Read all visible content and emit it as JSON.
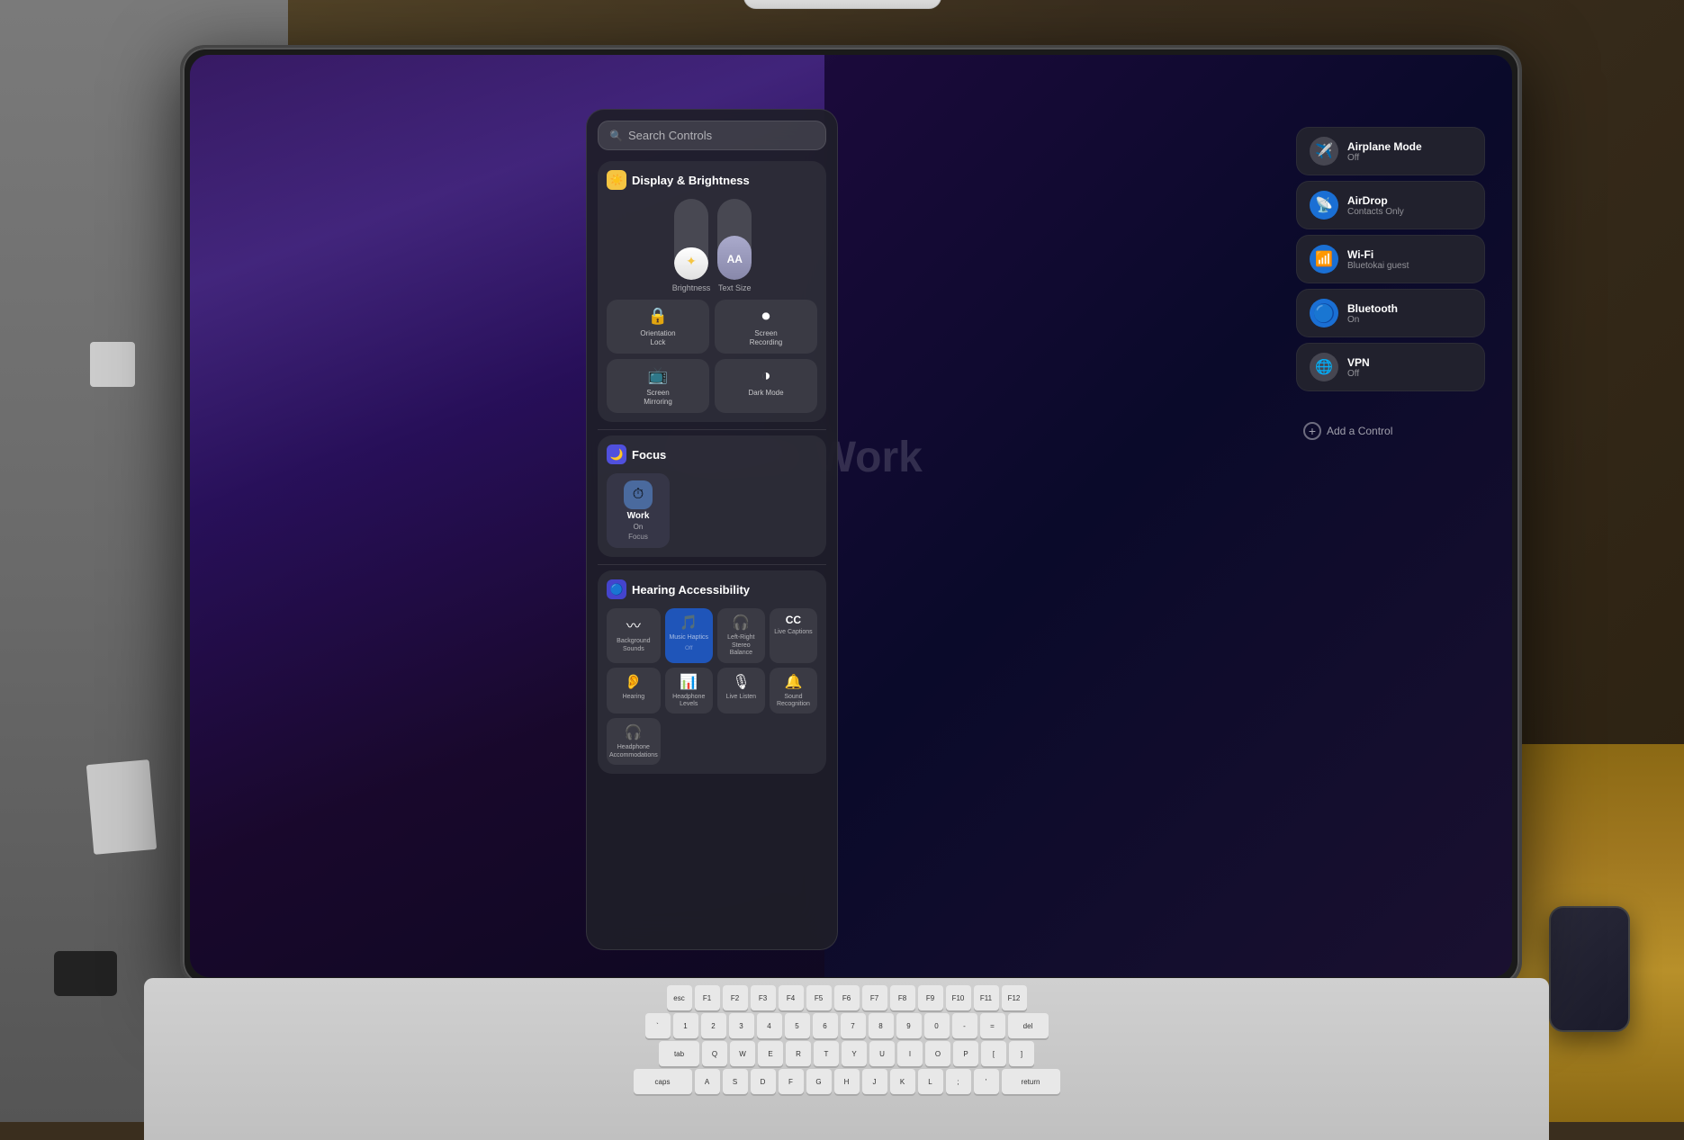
{
  "scene": {
    "apple_pencil": "Apple Pencil"
  },
  "search": {
    "placeholder": "Search Controls",
    "icon": "🔍"
  },
  "display_section": {
    "title": "Display & Brightness",
    "icon": "☀️",
    "icon_color": "#f5c542",
    "brightness_label": "Brightness",
    "text_size_label": "Text Size",
    "controls": [
      {
        "label": "Orientation\nLock",
        "icon": "🔒",
        "active": false
      },
      {
        "label": "Screen\nRecording",
        "icon": "⏺",
        "active": false
      },
      {
        "label": "Screen\nMirroring",
        "icon": "📺",
        "active": false
      },
      {
        "label": "Dark Mode",
        "icon": "◑",
        "active": false
      }
    ]
  },
  "focus_section": {
    "title": "Focus",
    "icon": "🌙",
    "icon_color": "#5050dd",
    "items": [
      {
        "name": "Work",
        "status": "On",
        "label": "Focus",
        "icon": "⏱",
        "active": true
      }
    ]
  },
  "hearing_section": {
    "title": "Hearing Accessibility",
    "icon": "🔵",
    "icon_color": "#4444cc",
    "items": [
      {
        "label": "Background\nSounds",
        "icon": "〰",
        "sublabel": "",
        "active": false
      },
      {
        "label": "Music Haptics",
        "sublabel": "Off",
        "icon": "🎵",
        "active": true
      },
      {
        "label": "Left-Right\nStereo Balance",
        "icon": "🎧",
        "active": false
      },
      {
        "label": "Live Captions",
        "icon": "CC",
        "active": false
      },
      {
        "label": "Hearing",
        "icon": "👂",
        "active": false
      },
      {
        "label": "Headphone\nLevels",
        "icon": "📊",
        "active": false
      },
      {
        "label": "Live Listen",
        "icon": "🎙",
        "active": false
      },
      {
        "label": "Sound\nRecognition",
        "icon": "🔔",
        "active": false
      },
      {
        "label": "Headphone\nAccommodations",
        "icon": "🎧",
        "active": false
      }
    ]
  },
  "connectivity": {
    "items": [
      {
        "name": "Airplane Mode",
        "status": "Off",
        "icon": "✈️",
        "icon_bg": "gray"
      },
      {
        "name": "AirDrop",
        "status": "Contacts Only",
        "icon": "📡",
        "icon_bg": "blue"
      },
      {
        "name": "Wi-Fi",
        "status": "Bluetokai guest",
        "icon": "📶",
        "icon_bg": "blue"
      },
      {
        "name": "Bluetooth",
        "status": "On",
        "icon": "🔵",
        "icon_bg": "blue"
      },
      {
        "name": "VPN",
        "status": "Off",
        "icon": "🌐",
        "icon_bg": "gray"
      }
    ]
  },
  "add_control": {
    "label": "Add a Control",
    "icon": "+"
  },
  "focus_work_text": "Focus Work"
}
